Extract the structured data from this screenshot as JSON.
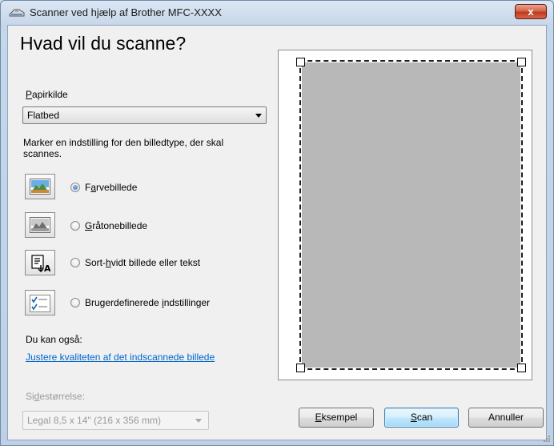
{
  "window": {
    "title": "Scanner ved hjælp af Brother MFC-XXXX",
    "close_label": "x"
  },
  "heading": "Hvad vil du scanne?",
  "paper_source": {
    "label_pre": "",
    "label_underline": "P",
    "label_post": "apirkilde",
    "selected": "Flatbed"
  },
  "instruction": "Marker en indstilling for den billedtype, der skal scannes.",
  "image_types": [
    {
      "pre": "F",
      "u": "a",
      "post": "rvebillede",
      "checked": true,
      "icon": "color-picture-icon"
    },
    {
      "pre": "",
      "u": "G",
      "post": "råtonebillede",
      "checked": false,
      "icon": "grayscale-picture-icon"
    },
    {
      "pre": "Sort-",
      "u": "h",
      "post": "vidt billede eller tekst",
      "checked": false,
      "icon": "black-white-text-icon"
    },
    {
      "pre": "Brugerdefinerede ",
      "u": "i",
      "post": "ndstillinger",
      "checked": false,
      "icon": "custom-settings-icon"
    }
  ],
  "also": {
    "label": "Du kan også:",
    "link": "Justere kvaliteten af det indscannede billede"
  },
  "page_size": {
    "label_pre": "Si",
    "label_underline": "d",
    "label_post": "estørrelse:",
    "selected": "Legal 8,5 x 14\" (216 x 356 mm)"
  },
  "buttons": {
    "preview_u": "E",
    "preview_rest": "ksempel",
    "scan_u": "S",
    "scan_rest": "can",
    "cancel": "Annuller"
  },
  "colors": {
    "link": "#0066cc",
    "preview_gray": "#b8b8b8",
    "close_red": "#c0391c"
  }
}
